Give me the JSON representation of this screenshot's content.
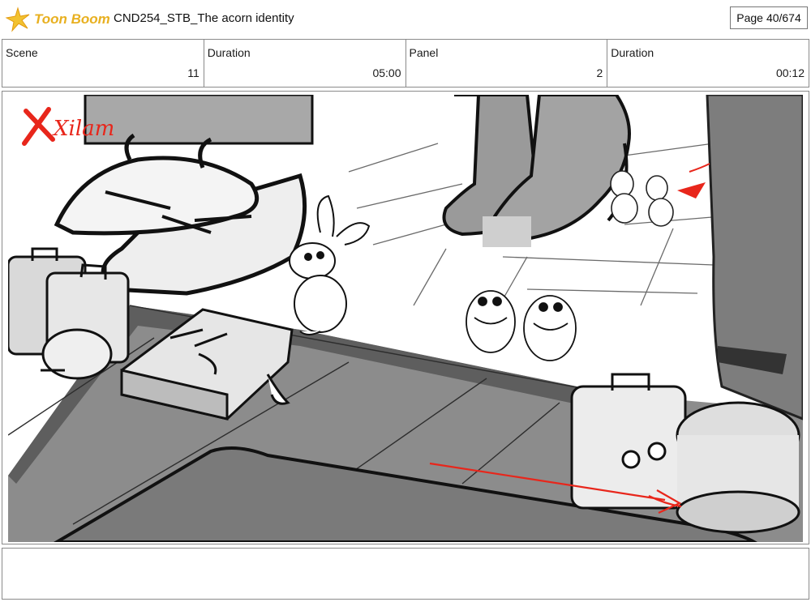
{
  "header": {
    "brand_name": "Toon Boom",
    "document_title": "CND254_STB_The acorn identity",
    "page_label": "Page",
    "page_value": "40/674"
  },
  "info": {
    "scene_label": "Scene",
    "scene_value": "11",
    "scene_duration_label": "Duration",
    "scene_duration_value": "05:00",
    "panel_label": "Panel",
    "panel_value": "2",
    "panel_duration_label": "Duration",
    "panel_duration_value": "00:12"
  },
  "artwork": {
    "watermark": "Xilam",
    "brand_color": "#e8b020",
    "accent_red": "#e8261b"
  },
  "notes": {
    "text": ""
  }
}
